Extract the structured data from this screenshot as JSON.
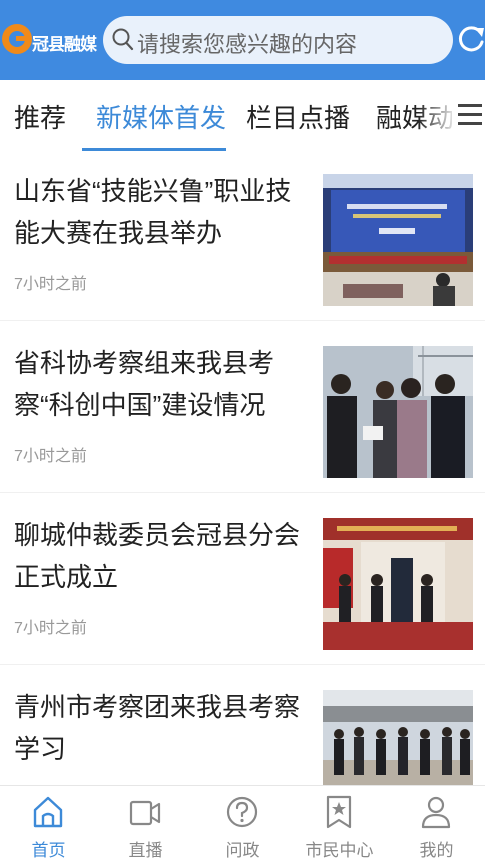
{
  "header": {
    "logo_text": "冠县融媒",
    "search_placeholder": "请搜索您感兴趣的内容",
    "search_icon": "search-icon",
    "refresh_icon": "refresh-icon"
  },
  "tabs": [
    {
      "label": "推荐",
      "active": false
    },
    {
      "label": "新媒体首发",
      "active": true
    },
    {
      "label": "栏目点播",
      "active": false
    },
    {
      "label": "融媒动态",
      "active": false
    }
  ],
  "menu_icon": "menu-icon",
  "articles": [
    {
      "title": "山东省“技能兴鲁”职业技能大赛在我县举办",
      "time": "7小时之前"
    },
    {
      "title": "省科协考察组来我县考察“科创中国”建设情况",
      "time": "7小时之前"
    },
    {
      "title": "聊城仲裁委员会冠县分会正式成立",
      "time": "7小时之前"
    },
    {
      "title": "青州市考察团来我县考察学习",
      "time": ""
    }
  ],
  "bottom_nav": [
    {
      "label": "首页",
      "icon": "home-icon",
      "active": true
    },
    {
      "label": "直播",
      "icon": "video-icon",
      "active": false
    },
    {
      "label": "问政",
      "icon": "question-icon",
      "active": false
    },
    {
      "label": "市民中心",
      "icon": "bookmark-star-icon",
      "active": false
    },
    {
      "label": "我的",
      "icon": "user-icon",
      "active": false
    }
  ],
  "colors": {
    "header_bg": "#3f8ae0",
    "accent": "#3d8ad8",
    "logo_orange": "#f08a1a"
  }
}
